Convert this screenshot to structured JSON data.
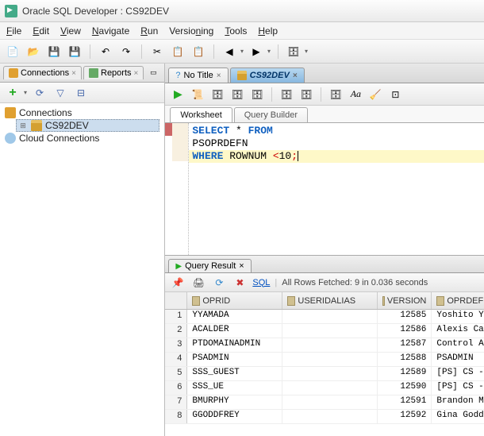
{
  "window": {
    "title": "Oracle SQL Developer : CS92DEV"
  },
  "menubar": [
    "File",
    "Edit",
    "View",
    "Navigate",
    "Run",
    "Versioning",
    "Tools",
    "Help"
  ],
  "left": {
    "tabs": {
      "connections": "Connections",
      "reports": "Reports"
    },
    "root": "Connections",
    "db": "CS92DEV",
    "cloud": "Cloud Connections"
  },
  "editor": {
    "tab_notitle": "No Title",
    "tab_active": "CS92DEV",
    "ws_tab": "Worksheet",
    "qb_tab": "Query Builder",
    "sql_line1_a": "SELECT",
    "sql_line1_b": " * ",
    "sql_line1_c": "FROM",
    "sql_line2": "PSOPRDEFN",
    "sql_line3_a": "WHERE",
    "sql_line3_b": " ROWNUM ",
    "sql_line3_c": "<",
    "sql_line3_d": "10",
    "sql_line3_e": ";"
  },
  "results": {
    "tab": "Query Result",
    "sql_link": "SQL",
    "status": "All Rows Fetched: 9 in 0.036 seconds",
    "columns": [
      "OPRID",
      "USERIDALIAS",
      "VERSION",
      "OPRDEFND"
    ],
    "rows": [
      {
        "n": "1",
        "oprid": "YYAMADA",
        "alias": "",
        "version": "12585",
        "defn": "Yoshito Yar"
      },
      {
        "n": "2",
        "oprid": "ACALDER",
        "alias": "",
        "version": "12586",
        "defn": "Alexis Cald"
      },
      {
        "n": "3",
        "oprid": "PTDOMAINADMIN",
        "alias": "",
        "version": "12587",
        "defn": "Control App"
      },
      {
        "n": "4",
        "oprid": "PSADMIN",
        "alias": "",
        "version": "12588",
        "defn": "PSADMIN"
      },
      {
        "n": "5",
        "oprid": "SSS_GUEST",
        "alias": "",
        "version": "12589",
        "defn": "[PS] CS - G"
      },
      {
        "n": "6",
        "oprid": "SSS_UE",
        "alias": "",
        "version": "12590",
        "defn": "[PS] CS - S"
      },
      {
        "n": "7",
        "oprid": "BMURPHY",
        "alias": "",
        "version": "12591",
        "defn": "Brandon Mu"
      },
      {
        "n": "8",
        "oprid": "GGODDFREY",
        "alias": "",
        "version": "12592",
        "defn": "Gina Goddre"
      }
    ]
  }
}
